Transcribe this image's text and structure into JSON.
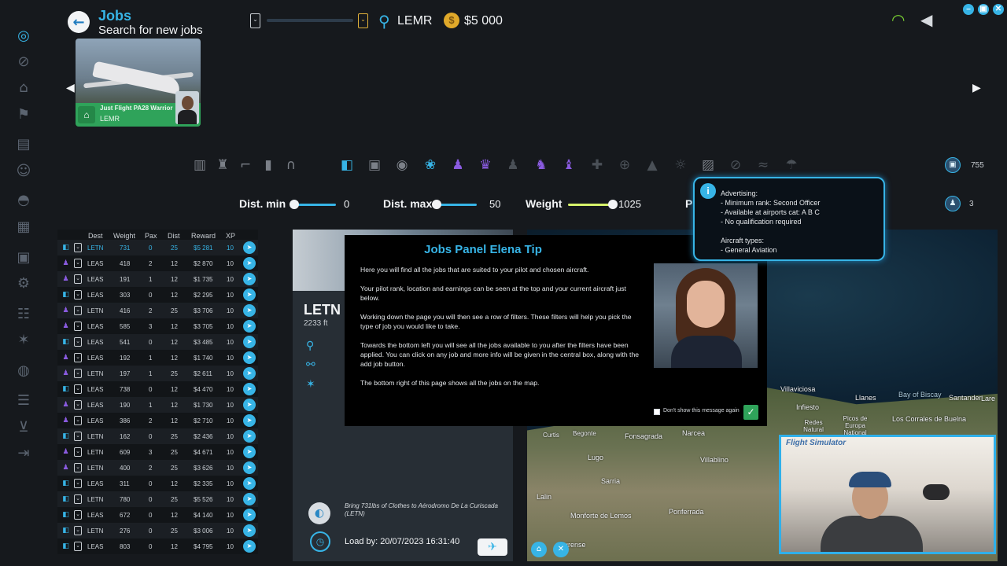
{
  "header": {
    "title": "Jobs",
    "subtitle": "Search for new jobs",
    "location": "LEMR",
    "money": "$5 000",
    "fuel_left_glyph": "⌄",
    "fuel_right_glyph": "⌄"
  },
  "window_buttons": [
    "–",
    "▣",
    "✕"
  ],
  "aircraft_card": {
    "name": "Just Flight PA28 Warrior",
    "location": "LEMR"
  },
  "counters": {
    "packages": "755",
    "pilots": "3"
  },
  "sliders": {
    "dist_min": {
      "label": "Dist. min",
      "value": "0",
      "fill": 0
    },
    "dist_max": {
      "label": "Dist. max",
      "value": "50",
      "fill": 0.02
    },
    "weight": {
      "label": "Weight",
      "value": "1025",
      "fill": 1
    },
    "fourth": {
      "label": "P"
    }
  },
  "table": {
    "headers": [
      "Dest",
      "Weight",
      "Pax",
      "Dist",
      "Reward",
      "XP"
    ],
    "rows": [
      {
        "type": "cargo",
        "dest": "LETN",
        "weight": "731",
        "pax": "0",
        "dist": "25",
        "reward": "$5 281",
        "xp": "10"
      },
      {
        "type": "pax",
        "dest": "LEAS",
        "weight": "418",
        "pax": "2",
        "dist": "12",
        "reward": "$2 870",
        "xp": "10"
      },
      {
        "type": "pax",
        "dest": "LEAS",
        "weight": "191",
        "pax": "1",
        "dist": "12",
        "reward": "$1 735",
        "xp": "10"
      },
      {
        "type": "cargo",
        "dest": "LEAS",
        "weight": "303",
        "pax": "0",
        "dist": "12",
        "reward": "$2 295",
        "xp": "10"
      },
      {
        "type": "pax",
        "dest": "LETN",
        "weight": "416",
        "pax": "2",
        "dist": "25",
        "reward": "$3 706",
        "xp": "10"
      },
      {
        "type": "pax",
        "dest": "LEAS",
        "weight": "585",
        "pax": "3",
        "dist": "12",
        "reward": "$3 705",
        "xp": "10"
      },
      {
        "type": "cargo",
        "dest": "LEAS",
        "weight": "541",
        "pax": "0",
        "dist": "12",
        "reward": "$3 485",
        "xp": "10"
      },
      {
        "type": "pax",
        "dest": "LEAS",
        "weight": "192",
        "pax": "1",
        "dist": "12",
        "reward": "$1 740",
        "xp": "10"
      },
      {
        "type": "pax",
        "dest": "LETN",
        "weight": "197",
        "pax": "1",
        "dist": "25",
        "reward": "$2 611",
        "xp": "10"
      },
      {
        "type": "cargo",
        "dest": "LEAS",
        "weight": "738",
        "pax": "0",
        "dist": "12",
        "reward": "$4 470",
        "xp": "10"
      },
      {
        "type": "pax",
        "dest": "LEAS",
        "weight": "190",
        "pax": "1",
        "dist": "12",
        "reward": "$1 730",
        "xp": "10"
      },
      {
        "type": "pax",
        "dest": "LEAS",
        "weight": "386",
        "pax": "2",
        "dist": "12",
        "reward": "$2 710",
        "xp": "10"
      },
      {
        "type": "cargo",
        "dest": "LETN",
        "weight": "162",
        "pax": "0",
        "dist": "25",
        "reward": "$2 436",
        "xp": "10"
      },
      {
        "type": "pax",
        "dest": "LETN",
        "weight": "609",
        "pax": "3",
        "dist": "25",
        "reward": "$4 671",
        "xp": "10"
      },
      {
        "type": "pax",
        "dest": "LETN",
        "weight": "400",
        "pax": "2",
        "dist": "25",
        "reward": "$3 626",
        "xp": "10"
      },
      {
        "type": "cargo",
        "dest": "LEAS",
        "weight": "311",
        "pax": "0",
        "dist": "12",
        "reward": "$2 335",
        "xp": "10"
      },
      {
        "type": "cargo",
        "dest": "LETN",
        "weight": "780",
        "pax": "0",
        "dist": "25",
        "reward": "$5 526",
        "xp": "10"
      },
      {
        "type": "cargo",
        "dest": "LEAS",
        "weight": "672",
        "pax": "0",
        "dist": "12",
        "reward": "$4 140",
        "xp": "10"
      },
      {
        "type": "cargo",
        "dest": "LETN",
        "weight": "276",
        "pax": "0",
        "dist": "25",
        "reward": "$3 006",
        "xp": "10"
      },
      {
        "type": "cargo",
        "dest": "LEAS",
        "weight": "803",
        "pax": "0",
        "dist": "12",
        "reward": "$4 795",
        "xp": "10"
      }
    ]
  },
  "detail": {
    "dest_code": "LETN",
    "dest_alt": "2233 ft",
    "description": "Bring 731lbs of Clothes to Aérodromo De La Curiscada (LETN)",
    "load_by": "Load by: 20/07/2023 16:31:40"
  },
  "map": {
    "labels": [
      "Villaviciosa",
      "Llanes",
      "Bay of Biscay",
      "Santander",
      "Lare",
      "Infiesto",
      "Redes Natural",
      "Picos de Europa National",
      "Los Corrales de Buelna",
      "Curtis",
      "Begonte",
      "Fonsagrada",
      "Narcea",
      "Lugo",
      "Villablino",
      "Sarria",
      "Lalin",
      "Monforte de Lemos",
      "Ponferrada",
      "Ourense"
    ]
  },
  "webcam": {
    "logo": "Flight Simulator"
  },
  "tip": {
    "title": "Jobs Panel Elena Tip",
    "paragraphs": [
      "Here you will find all the jobs that are suited to your pilot and chosen aircraft.",
      "Your pilot rank, location and earnings can be seen at the top and your current aircraft just below.",
      "Working down the page you will then see a row of filters.  These filters will help you pick the type of job you would like to take.",
      "Towards the bottom left you will see all the jobs available to you after the filters have been applied.  You can click on any job and more info will be given in the central box, along with the add job button.",
      "The bottom right of this page shows all the jobs on the map."
    ],
    "dont_show": "Don't show this message again"
  },
  "tooltip": {
    "title": "Advertising:",
    "lines": [
      "- Minimum rank: Second Officer",
      "- Available at airports cat: A B C",
      "- No qualification required"
    ],
    "aircraft_title": "Aircraft types:",
    "aircraft_lines": [
      "- General Aviation"
    ]
  },
  "filter_icons": [
    "cargo-disabled-icon",
    "trophy-disabled-icon",
    "crane-disabled-icon",
    "fuel-disabled-icon",
    "headset-disabled-icon",
    "cargo-box-icon",
    "briefcase-icon",
    "camera-icon",
    "parcel-icon",
    "passenger-icon",
    "vip-passenger-icon",
    "passenger-disabled-icon",
    "photo-passenger-icon",
    "group-passenger-icon",
    "medical-icon",
    "sport-icon",
    "fire-icon",
    "skydive-icon",
    "advertising-icon",
    "tour-icon",
    "airshow-icon",
    "parachute-icon"
  ],
  "colors": {
    "accent": "#37b4e6",
    "purple": "#8a5be0",
    "green": "#2fa35a",
    "gold": "#e0a92a",
    "bg": "#16191d"
  }
}
